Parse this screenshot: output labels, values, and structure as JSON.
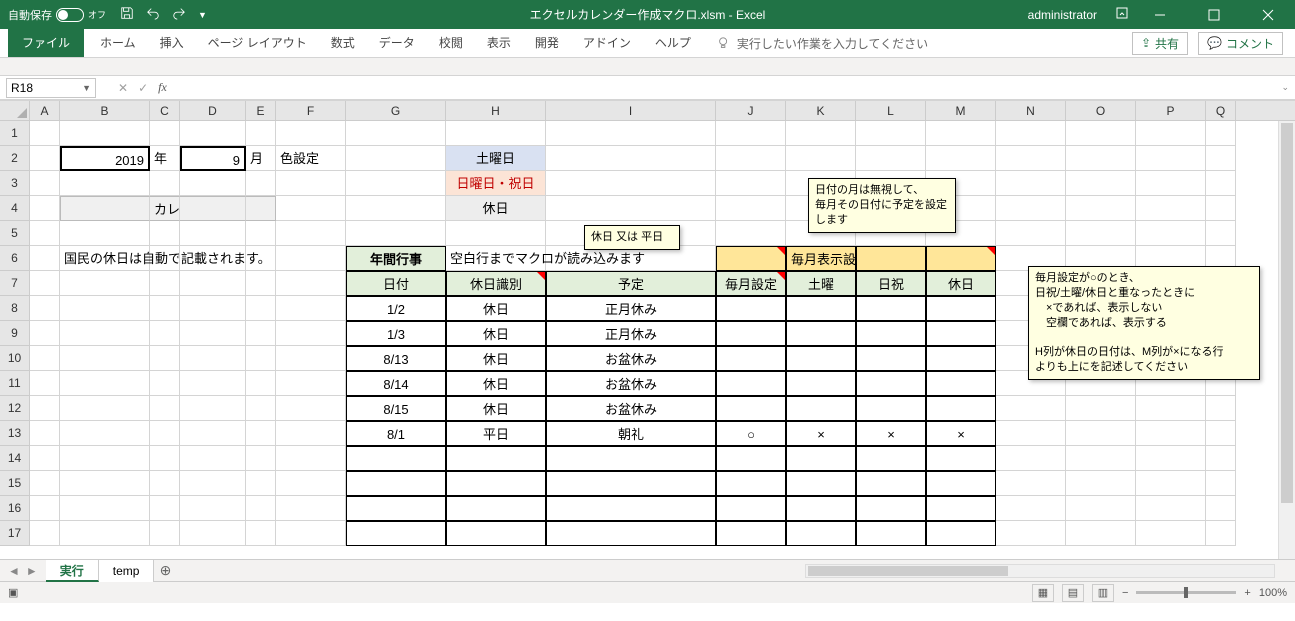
{
  "titlebar": {
    "autosave_label": "自動保存",
    "autosave_state": "オフ",
    "filename": "エクセルカレンダー作成マクロ.xlsm  -  Excel",
    "user": "administrator"
  },
  "ribbon": {
    "file": "ファイル",
    "tabs": [
      "ホーム",
      "挿入",
      "ページ レイアウト",
      "数式",
      "データ",
      "校閲",
      "表示",
      "開発",
      "アドイン",
      "ヘルプ"
    ],
    "tellme_placeholder": "実行したい作業を入力してください",
    "share": "共有",
    "comment": "コメント"
  },
  "namebox": "R18",
  "sheet": {
    "year": "2019",
    "year_suffix": "年",
    "month": "9",
    "month_suffix": "月",
    "color_label": "色設定",
    "saturday": "土曜日",
    "sunday": "日曜日・祝日",
    "holiday": "休日",
    "btn_create": "カレンダーの作成",
    "note_auto": "国民の休日は自動で記載されます。",
    "hdr_annual": "年間行事",
    "hdr_blank": "空白行までマクロが読み込みます",
    "hdr_monthly": "毎月表示設定用",
    "col_date": "日付",
    "col_type": "休日識別",
    "col_event": "予定",
    "col_msetting": "毎月設定",
    "col_sat": "土曜",
    "col_sunhol": "日祝",
    "col_hol": "休日",
    "rows": [
      {
        "date": "1/2",
        "type": "休日",
        "event": "正月休み",
        "m": "",
        "s": "",
        "d": "",
        "h": ""
      },
      {
        "date": "1/3",
        "type": "休日",
        "event": "正月休み",
        "m": "",
        "s": "",
        "d": "",
        "h": ""
      },
      {
        "date": "8/13",
        "type": "休日",
        "event": "お盆休み",
        "m": "",
        "s": "",
        "d": "",
        "h": ""
      },
      {
        "date": "8/14",
        "type": "休日",
        "event": "お盆休み",
        "m": "",
        "s": "",
        "d": "",
        "h": ""
      },
      {
        "date": "8/15",
        "type": "休日",
        "event": "お盆休み",
        "m": "",
        "s": "",
        "d": "",
        "h": ""
      },
      {
        "date": "8/1",
        "type": "平日",
        "event": "朝礼",
        "m": "○",
        "s": "×",
        "d": "×",
        "h": "×"
      }
    ],
    "note1": "休日 又は 平日",
    "note2": "日付の月は無視して、\n毎月その日付に予定を設定します",
    "note3": "毎月設定が○のとき、\n日祝/土曜/休日と重なったときに\n　×であれば、表示しない\n　空欄であれば、表示する\n\nH列が休日の日付は、M列が×になる行\nよりも上にを記述してください"
  },
  "tabs": {
    "active": "実行",
    "other": "temp"
  },
  "status": {
    "zoom": "100%"
  },
  "columns": [
    "A",
    "B",
    "C",
    "D",
    "E",
    "F",
    "G",
    "H",
    "I",
    "J",
    "K",
    "L",
    "M",
    "N",
    "O",
    "P",
    "Q"
  ]
}
